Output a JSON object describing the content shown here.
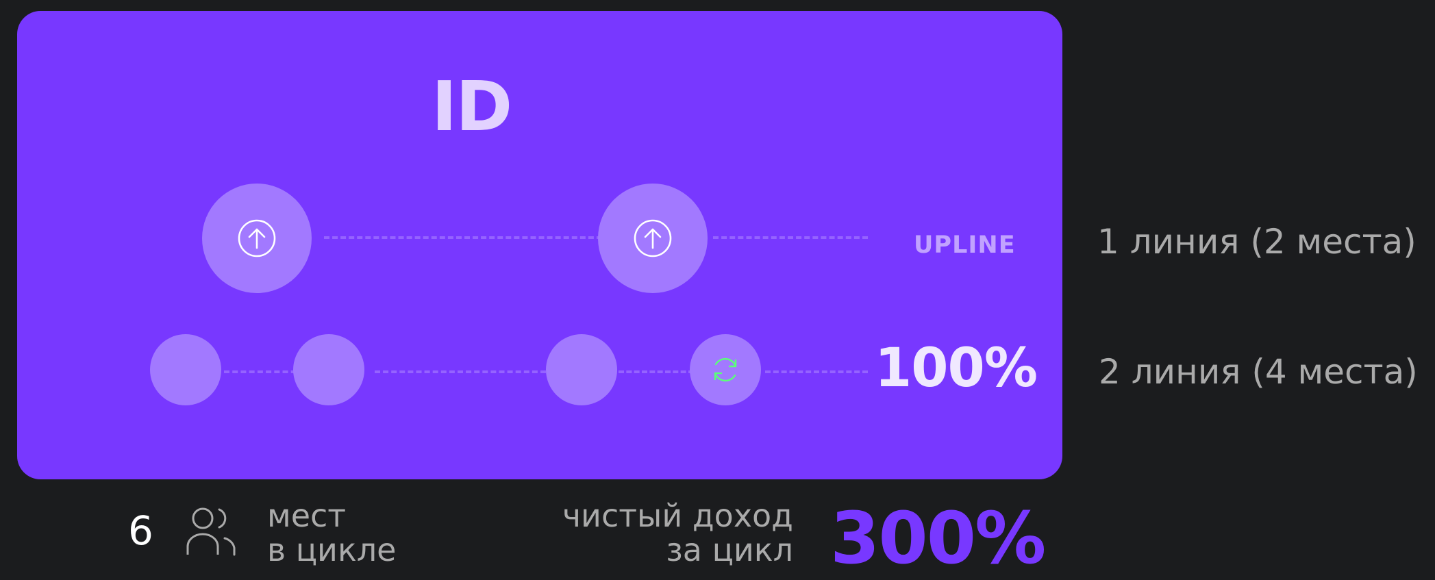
{
  "card": {
    "title": "ID",
    "upline_label": "UPLINE",
    "percent_label": "100%",
    "colors": {
      "card_bg": "#7838ff",
      "node_fill": "#a279ff",
      "refresh_icon": "#5bff7a"
    },
    "icons": {
      "upline_node_1": "arrow-up-circle-icon",
      "upline_node_2": "arrow-up-circle-icon",
      "second_line_node_4": "refresh-icon"
    }
  },
  "side_labels": {
    "line1": "1 линия (2 места)",
    "line2": "2 линия (4 места)"
  },
  "bottom": {
    "places_count": "6",
    "places_icon": "users-icon",
    "places_line1": "мест",
    "places_line2": "в цикле",
    "income_line1": "чистый доход",
    "income_line2": "за цикл",
    "income_percent": "300%"
  }
}
